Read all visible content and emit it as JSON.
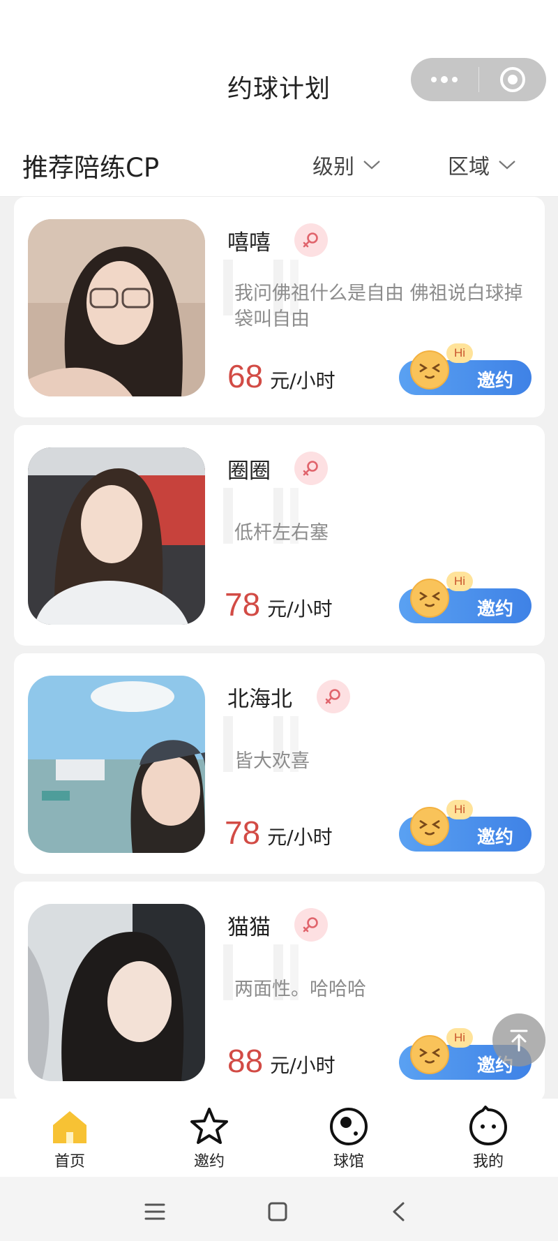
{
  "header": {
    "title": "约球计划",
    "capsule": {
      "menu_icon": "more-dots-icon",
      "close_icon": "target-circle-icon"
    }
  },
  "filter": {
    "title": "推荐陪练CP",
    "level_label": "级别",
    "area_label": "区域"
  },
  "cards": [
    {
      "name": "嘻嘻",
      "gender": "female",
      "bio": "我问佛祖什么是自由 佛祖说白球掉袋叫自由",
      "price": "68",
      "unit": "元/小时",
      "button": "邀约",
      "hi": "Hi"
    },
    {
      "name": "圈圈",
      "gender": "female",
      "bio": "低杆左右塞",
      "price": "78",
      "unit": "元/小时",
      "button": "邀约",
      "hi": "Hi"
    },
    {
      "name": "北海北",
      "gender": "female",
      "bio": "皆大欢喜",
      "price": "78",
      "unit": "元/小时",
      "button": "邀约",
      "hi": "Hi"
    },
    {
      "name": "猫猫",
      "gender": "female",
      "bio": "两面性。哈哈哈",
      "price": "88",
      "unit": "元/小时",
      "button": "邀约",
      "hi": "Hi"
    }
  ],
  "tabs": [
    {
      "label": "首页",
      "icon": "home-icon",
      "active": true
    },
    {
      "label": "邀约",
      "icon": "star-icon",
      "active": false
    },
    {
      "label": "球馆",
      "icon": "ball-icon",
      "active": false
    },
    {
      "label": "我的",
      "icon": "profile-face-icon",
      "active": false
    }
  ],
  "colors": {
    "price": "#d24b45",
    "invite_button": "#4a8ef0",
    "home_tab_active": "#f7c234",
    "gender_badge": "#fde0e2"
  }
}
